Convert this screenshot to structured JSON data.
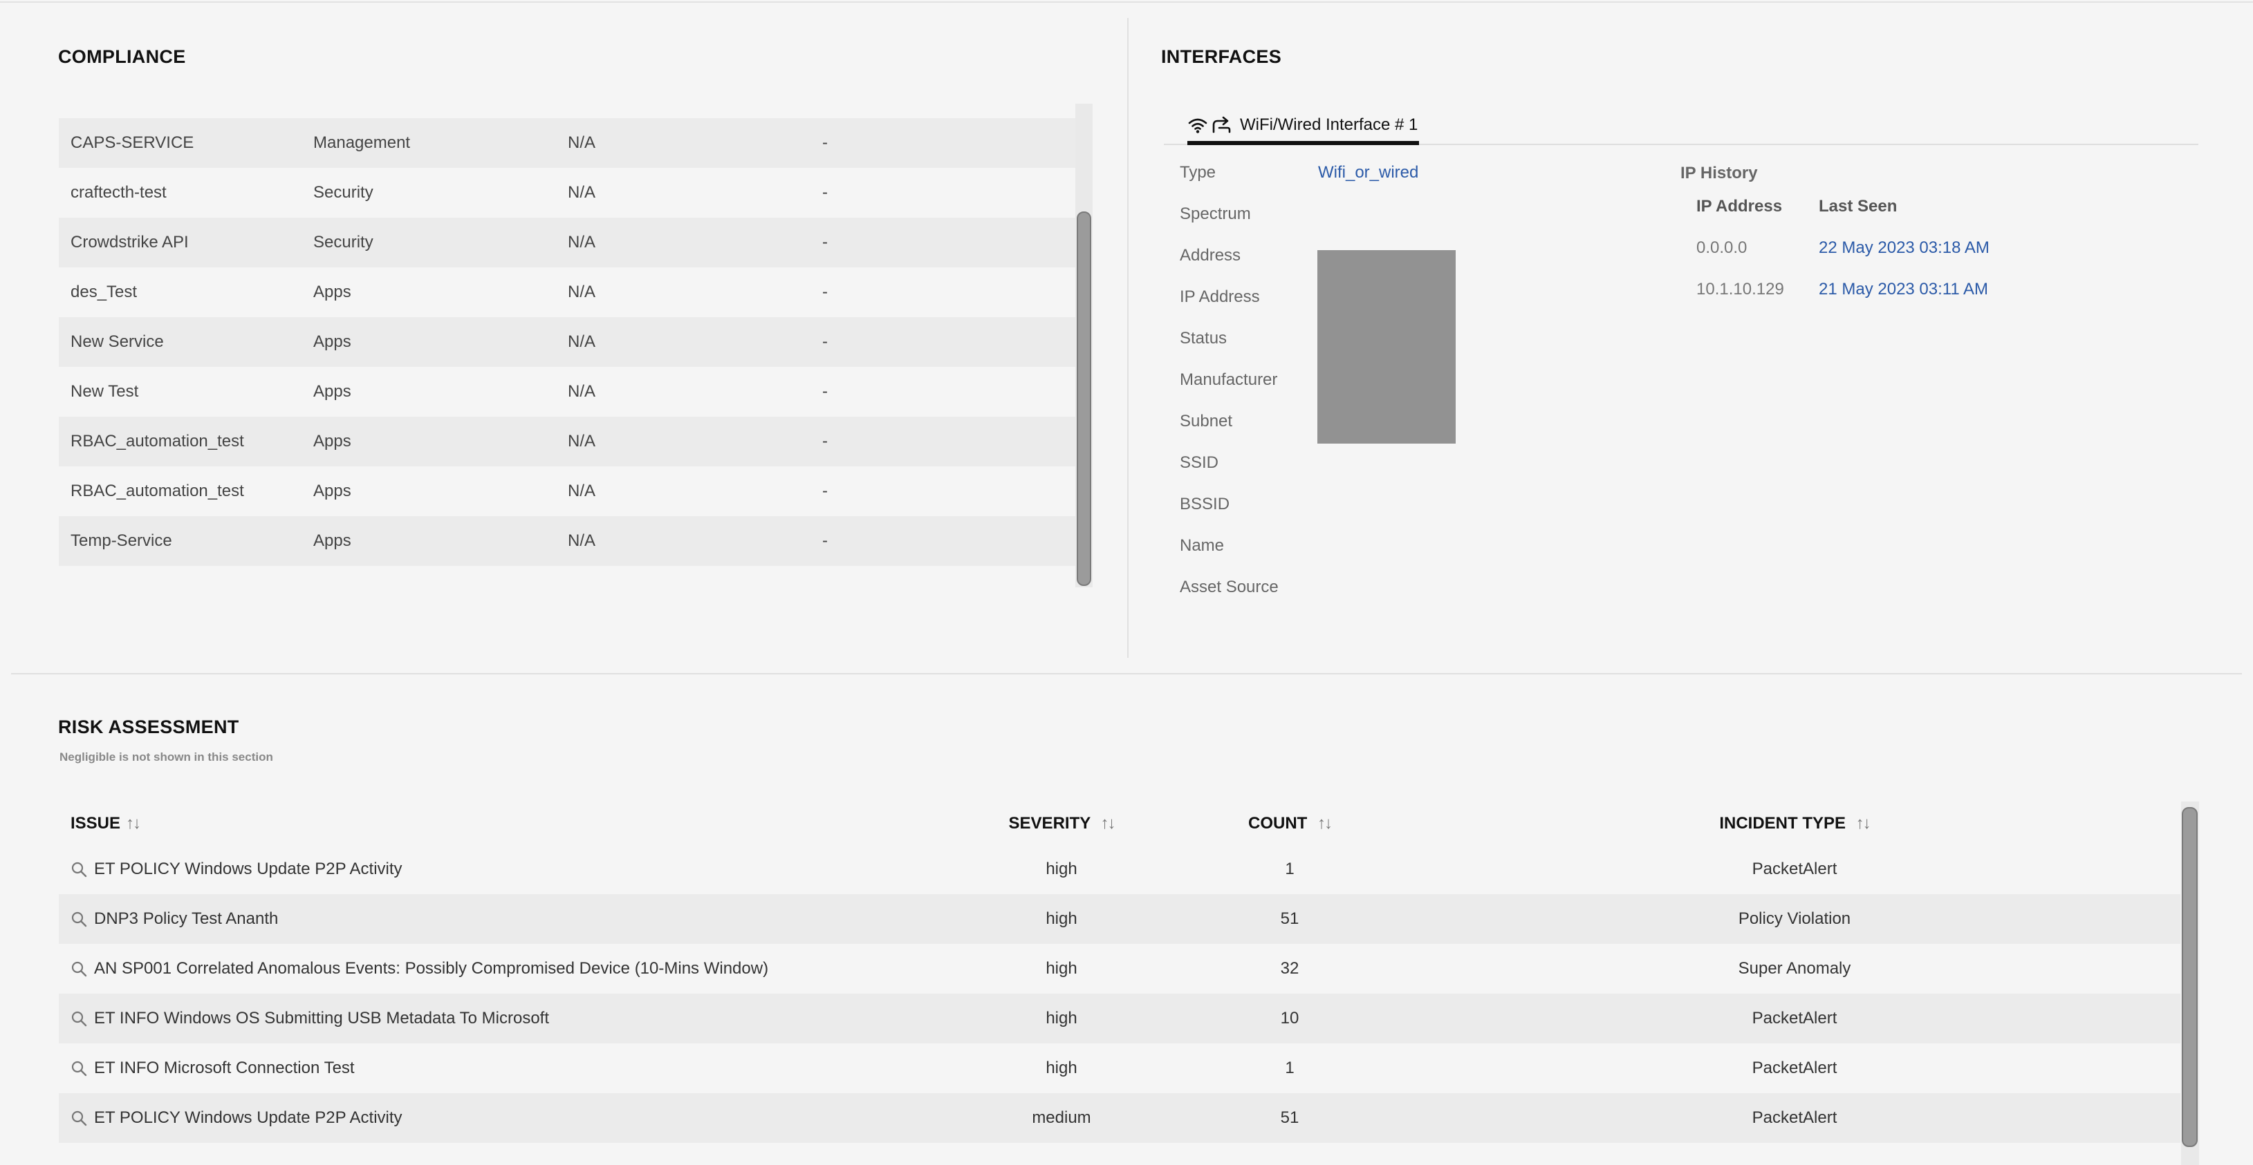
{
  "compliance": {
    "title": "COMPLIANCE",
    "rows": [
      {
        "name": "CAPS-SERVICE",
        "category": "Management",
        "status": "N/A",
        "extra": "-"
      },
      {
        "name": "craftecth-test",
        "category": "Security",
        "status": "N/A",
        "extra": "-"
      },
      {
        "name": "Crowdstrike API",
        "category": "Security",
        "status": "N/A",
        "extra": "-"
      },
      {
        "name": "des_Test",
        "category": "Apps",
        "status": "N/A",
        "extra": "-"
      },
      {
        "name": "New Service",
        "category": "Apps",
        "status": "N/A",
        "extra": "-"
      },
      {
        "name": "New Test",
        "category": "Apps",
        "status": "N/A",
        "extra": "-"
      },
      {
        "name": "RBAC_automation_test",
        "category": "Apps",
        "status": "N/A",
        "extra": "-"
      },
      {
        "name": "RBAC_automation_test",
        "category": "Apps",
        "status": "N/A",
        "extra": "-"
      },
      {
        "name": "Temp-Service",
        "category": "Apps",
        "status": "N/A",
        "extra": "-"
      }
    ]
  },
  "interfaces": {
    "title": "INTERFACES",
    "tab_label": "WiFi/Wired Interface # 1",
    "properties": [
      {
        "label": "Type",
        "value": "Wifi_or_wired"
      },
      {
        "label": "Spectrum",
        "value": ""
      },
      {
        "label": "Address",
        "value": ""
      },
      {
        "label": "IP Address",
        "value": ""
      },
      {
        "label": "Status",
        "value": ""
      },
      {
        "label": "Manufacturer",
        "value": ""
      },
      {
        "label": "Subnet",
        "value": ""
      },
      {
        "label": "SSID",
        "value": ""
      },
      {
        "label": "BSSID",
        "value": ""
      },
      {
        "label": "Name",
        "value": ""
      },
      {
        "label": "Asset Source",
        "value": ""
      }
    ],
    "ip_history": {
      "title": "IP History",
      "col_ip": "IP Address",
      "col_seen": "Last Seen",
      "rows": [
        {
          "ip": "0.0.0.0",
          "seen": "22 May 2023 03:18 AM"
        },
        {
          "ip": "10.1.10.129",
          "seen": "21 May 2023 03:11 AM"
        }
      ]
    }
  },
  "risk": {
    "title": "RISK ASSESSMENT",
    "note": "Negligible is not shown in this section",
    "columns": {
      "issue": "ISSUE",
      "severity": "SEVERITY",
      "count": "COUNT",
      "incident_type": "INCIDENT TYPE"
    },
    "sort_arrows": "↑↓",
    "rows": [
      {
        "issue": "ET POLICY Windows Update P2P Activity",
        "severity": "high",
        "count": "1",
        "incident_type": "PacketAlert"
      },
      {
        "issue": "DNP3 Policy Test Ananth",
        "severity": "high",
        "count": "51",
        "incident_type": "Policy Violation"
      },
      {
        "issue": "AN SP001 Correlated Anomalous Events: Possibly Compromised Device (10-Mins Window)",
        "severity": "high",
        "count": "32",
        "incident_type": "Super Anomaly"
      },
      {
        "issue": "ET INFO Windows OS Submitting USB Metadata To Microsoft",
        "severity": "high",
        "count": "10",
        "incident_type": "PacketAlert"
      },
      {
        "issue": "ET INFO Microsoft Connection Test",
        "severity": "high",
        "count": "1",
        "incident_type": "PacketAlert"
      },
      {
        "issue": "ET POLICY Windows Update P2P Activity",
        "severity": "medium",
        "count": "51",
        "incident_type": "PacketAlert"
      }
    ]
  },
  "colors": {
    "link": "#2b5aa8",
    "alt_row": "#ebebeb",
    "background": "#f5f5f5"
  }
}
